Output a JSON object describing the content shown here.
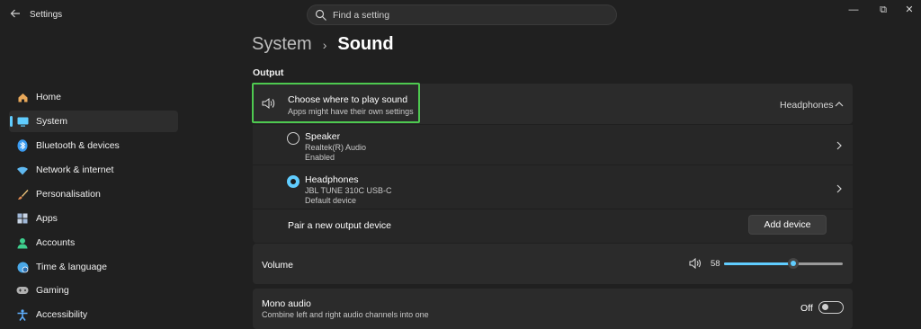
{
  "titlebar": {
    "app_title": "Settings",
    "back_icon": "back-arrow-icon"
  },
  "search": {
    "placeholder": "Find a setting"
  },
  "window_controls": {
    "minimize": "—",
    "maximize": "⧉",
    "close": "✕"
  },
  "sidebar": {
    "items": [
      {
        "label": "Home",
        "icon": "home-icon",
        "color": "#e8a85a"
      },
      {
        "label": "System",
        "icon": "system-icon",
        "color": "#60cdff",
        "active": true
      },
      {
        "label": "Bluetooth & devices",
        "icon": "bluetooth-icon",
        "color": "#3a9bf0"
      },
      {
        "label": "Network & internet",
        "icon": "wifi-icon",
        "color": "#5fb8f0"
      },
      {
        "label": "Personalisation",
        "icon": "brush-icon",
        "color": "#e0a060"
      },
      {
        "label": "Apps",
        "icon": "apps-icon",
        "color": "#a0b8d8"
      },
      {
        "label": "Accounts",
        "icon": "account-icon",
        "color": "#3ecf8e"
      },
      {
        "label": "Time & language",
        "icon": "globe-clock-icon",
        "color": "#4aa8e8"
      },
      {
        "label": "Gaming",
        "icon": "gamepad-icon",
        "color": "#b0b0b0"
      },
      {
        "label": "Accessibility",
        "icon": "accessibility-icon",
        "color": "#5fb0ff"
      }
    ]
  },
  "breadcrumb": {
    "parent": "System",
    "separator": "›",
    "current": "Sound"
  },
  "output": {
    "section_label": "Output",
    "choose": {
      "title": "Choose where to play sound",
      "subtitle": "Apps might have their own settings",
      "selected_value": "Headphones"
    },
    "devices": [
      {
        "name": "Speaker",
        "detail": "Realtek(R) Audio",
        "status": "Enabled",
        "selected": false
      },
      {
        "name": "Headphones",
        "detail": "JBL TUNE 310C USB-C",
        "status": "Default device",
        "selected": true
      }
    ],
    "pair": {
      "label": "Pair a new output device",
      "button": "Add device"
    }
  },
  "volume": {
    "label": "Volume",
    "value": "58",
    "level": 0.58
  },
  "mono": {
    "title": "Mono audio",
    "subtitle": "Combine left and right audio channels into one",
    "state": "Off"
  },
  "colors": {
    "accent": "#60cdff",
    "highlight": "#4ec950",
    "background": "#202020",
    "card": "#2b2b2b"
  }
}
